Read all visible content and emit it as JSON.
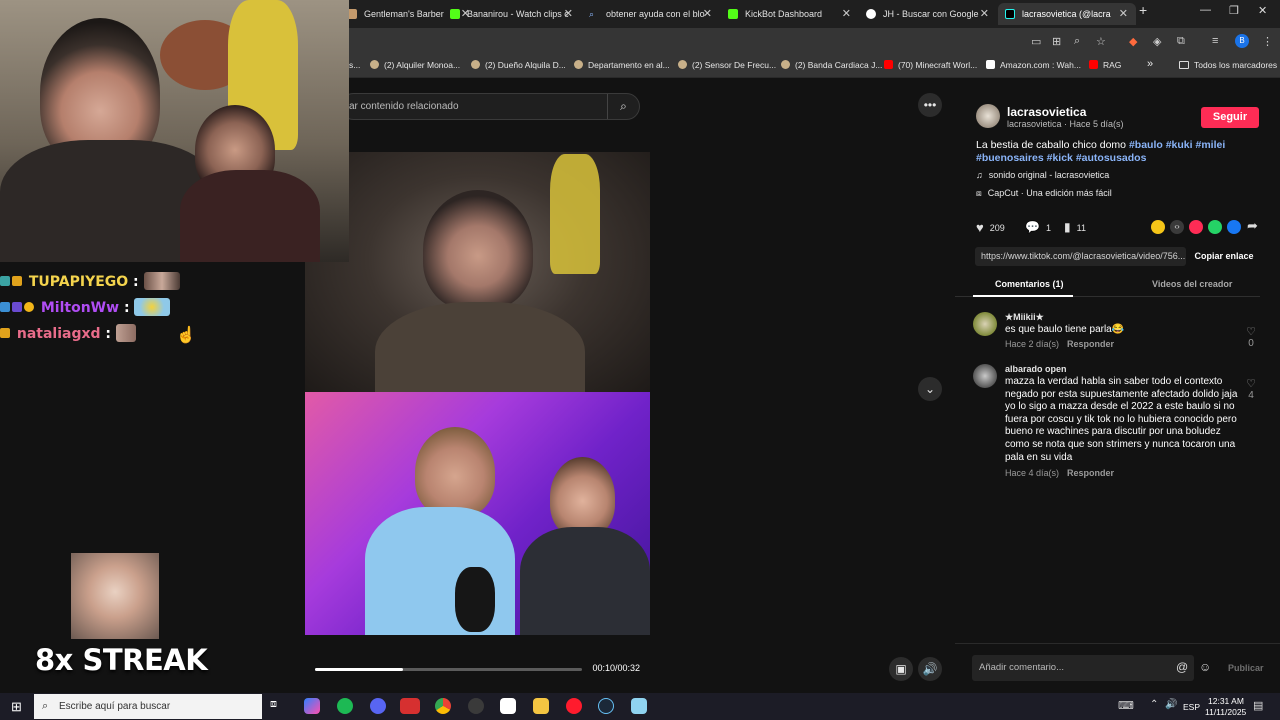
{
  "browser": {
    "tabs": [
      {
        "label": "Gentleman's Barber",
        "color": "#c49a6c"
      },
      {
        "label": "Bananirou - Watch clips c",
        "color": "#53fc18"
      },
      {
        "label": "obtener ayuda con el blo",
        "color": "#8ab4f8"
      },
      {
        "label": "KickBot Dashboard",
        "color": "#53fc18"
      },
      {
        "label": "JH - Buscar con Google",
        "color": "#ffffff"
      },
      {
        "label": "lacrasovietica (@lacra",
        "color": "#000000"
      }
    ],
    "bookmarks": [
      "s...",
      "(2) Alquiler Monoa...",
      "(2) Dueño Alquila D...",
      "Departamento en al...",
      "(2) Sensor De Frecu...",
      "(2) Banda Cardiaca J...",
      "(70) Minecraft Worl...",
      "Amazon.com : Wah...",
      "RAG"
    ],
    "all_bookmarks": "Todos los marcadores",
    "profile_initial": "B"
  },
  "search": {
    "placeholder": "ar contenido relacionado"
  },
  "video": {
    "time": "00:10/00:32",
    "progress": 0.33
  },
  "chat": {
    "lines": [
      {
        "user": "TUPAPIYEGO",
        "color": "#f4d44d"
      },
      {
        "user": "MiltonWw",
        "color": "#b04df4"
      },
      {
        "user": "nataliagxd",
        "color": "#e86c8a"
      }
    ],
    "separator": ":"
  },
  "streak": {
    "label": "8x STREAK"
  },
  "creator": {
    "name": "lacrasovietica",
    "sub": "lacrasovietica · Hace 5 día(s)",
    "follow": "Seguir",
    "desc_text": "La bestia de caballo chico domo ",
    "hashtags": [
      "#baulo",
      "#kuki",
      "#milei",
      "#buenosaires",
      "#kick",
      "#autosusados"
    ],
    "sound": "sonido original - lacrasovietica",
    "capcut": "CapCut · Una edición más fácil"
  },
  "actions": {
    "likes": "209",
    "comments": "1",
    "saves": "11"
  },
  "share": {
    "url": "https://www.tiktok.com/@lacrasovietica/video/756...",
    "copy": "Copiar enlace"
  },
  "tabs": {
    "comments": "Comentarios (1)",
    "creator_videos": "Videos del creador"
  },
  "comments": [
    {
      "user": "★Miikii★",
      "text": "es que baulo tiene parla😂",
      "meta": "Hace 2 día(s)",
      "reply": "Responder",
      "likes": "0"
    },
    {
      "user": "albarado open",
      "text": "mazza la verdad habla sin saber todo el contexto negado por esta supuestamente afectado dolido jaja yo lo sigo a mazza desde el 2022 a este baulo si no fuera por coscu y tik tok no lo hubiera conocido pero bueno re wachines para discutir por una boludez como se nota que son strimers y nunca tocaron una pala en su vida",
      "meta": "Hace 4 día(s)",
      "reply": "Responder",
      "likes": "4"
    }
  ],
  "comment_input": {
    "placeholder": "Añadir comentario...",
    "publish": "Publicar"
  },
  "taskbar": {
    "search_placeholder": "Escribe aquí para buscar",
    "lang": "ESP",
    "time": "12:31 AM",
    "date": "11/11/2025"
  }
}
